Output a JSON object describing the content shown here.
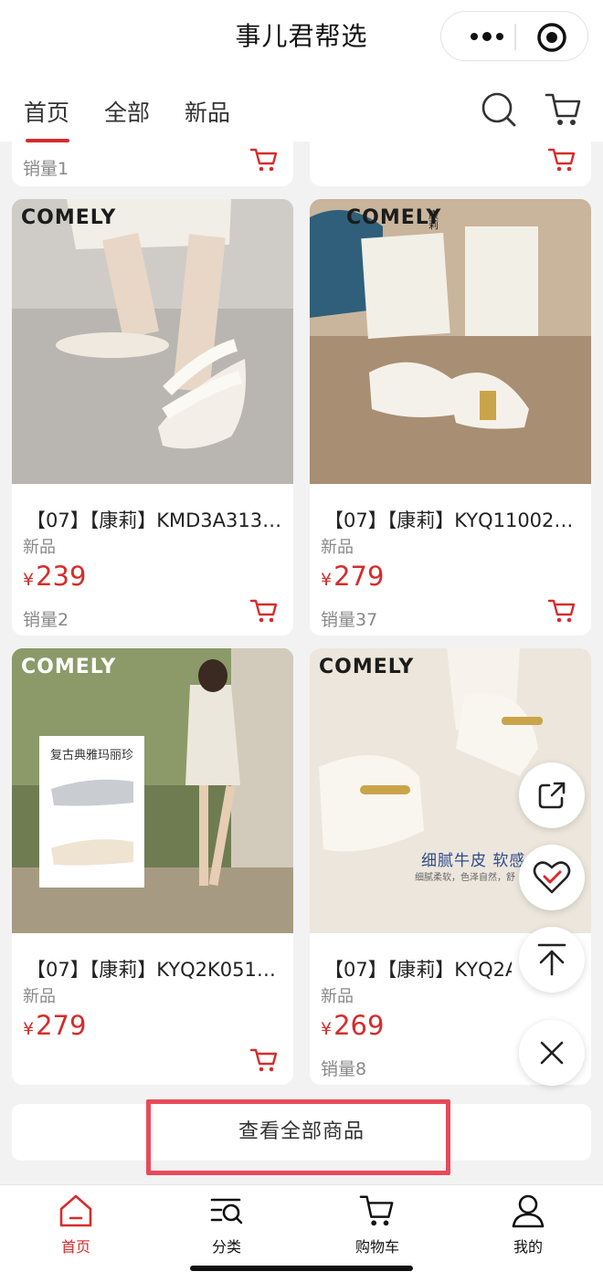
{
  "app": {
    "title": "事儿君帮选"
  },
  "tabs": [
    {
      "label": "首页",
      "active": true
    },
    {
      "label": "全部"
    },
    {
      "label": "新品"
    }
  ],
  "icons": {
    "more": "more-dots-icon",
    "close_target": "target-icon",
    "search": "search-icon",
    "cart": "cart-icon"
  },
  "top_partial": [
    {
      "sales": "销量1"
    },
    {
      "sales": ""
    }
  ],
  "products": [
    {
      "brand": "COMELY",
      "name": "【07】【康莉】KMD3A313…",
      "tag": "新品",
      "currency": "¥",
      "price": "239",
      "sales": "销量2"
    },
    {
      "brand": "COMELY",
      "brand_cn": "康莉",
      "name": "【07】【康莉】KYQ11002…",
      "tag": "新品",
      "currency": "¥",
      "price": "279",
      "sales": "销量37"
    },
    {
      "brand": "COMELY",
      "name": "【07】【康莉】KYQ2K051…",
      "tag": "新品",
      "currency": "¥",
      "price": "279",
      "sales": "",
      "overlay": "复古典雅玛丽珍"
    },
    {
      "brand": "COMELY",
      "name": "【07】【康莉】KYQ2A1",
      "tag": "新品",
      "currency": "¥",
      "price": "269",
      "sales": "销量8",
      "overlay": "细腻牛皮 软感",
      "overlay_sub": "细腻柔软，色泽自然，舒"
    }
  ],
  "view_all": "查看全部商品",
  "float_buttons": [
    "share-icon",
    "favorite-icon",
    "back-to-top-icon",
    "close-icon"
  ],
  "tabbar": [
    {
      "label": "首页",
      "icon": "home-icon",
      "active": true
    },
    {
      "label": "分类",
      "icon": "category-icon"
    },
    {
      "label": "购物车",
      "icon": "cart-icon"
    },
    {
      "label": "我的",
      "icon": "user-icon"
    }
  ],
  "colors": {
    "accent": "#d62c2c",
    "highlight_box": "#e94a5a"
  }
}
